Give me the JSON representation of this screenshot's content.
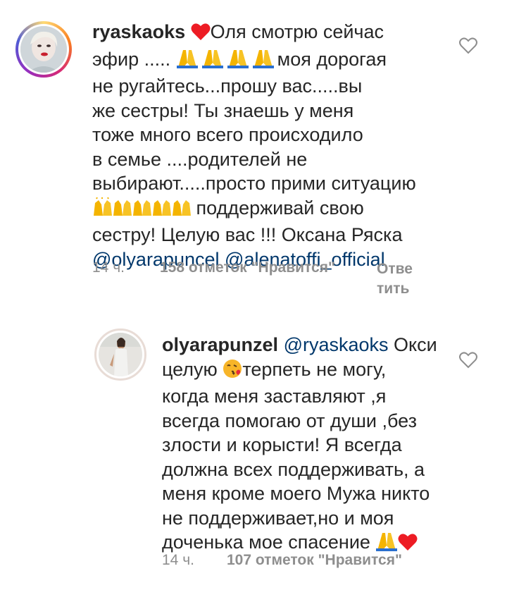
{
  "comments": [
    {
      "username": "ryaskaoks",
      "text_lines": [
        "Оля смотрю сейчас",
        "эфир .....",
        "моя дорогая",
        "не ругайтесь...прошу вас.....вы",
        "же сестры! Ты знаешь у меня",
        "тоже много всего происходило",
        "в семье ....родителей не",
        "выбирают.....просто прими ситуацию",
        "поддерживай свою",
        "сестру! Целую вас !!! Оксана Ряска"
      ],
      "mentions": [
        "@olyarapuncel",
        "@alenatoffi_official"
      ],
      "time": "14 ч.",
      "likes": "158 отметок \"Нравится\"",
      "reply_line1": "Отве",
      "reply_line2": "тить"
    },
    {
      "username": "olyarapunzel",
      "mention": "@ryaskaoks",
      "text_lines": [
        "Окси",
        "целую",
        "терпеть не могу,",
        "когда меня заставляют ,я",
        "всегда помогаю от души ,без",
        "злости и корысти! Я всегда",
        "должна всех поддерживать, а",
        "меня кроме моего Мужа никто",
        "не поддерживает,но и моя",
        "доченька мое спасение"
      ],
      "time": "14 ч.",
      "likes": "107 отметок \"Нравится\""
    }
  ],
  "icons": {
    "like": "heart-outline-icon",
    "red_heart": "red-heart-emoji",
    "pray": "folded-hands-emoji",
    "clap": "raising-hands-emoji",
    "kiss": "face-blowing-kiss-emoji"
  },
  "colors": {
    "text": "#262626",
    "mention": "#00376b",
    "meta": "#8e8e8e",
    "heart": "#ed1c24"
  }
}
